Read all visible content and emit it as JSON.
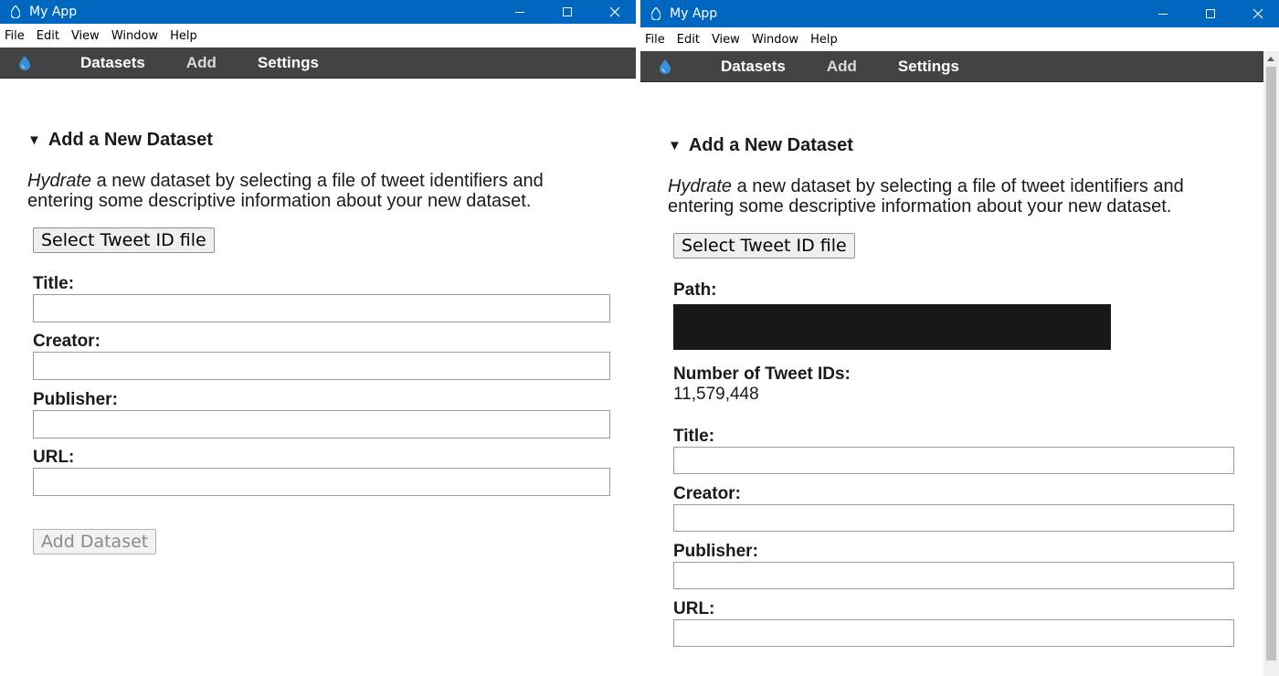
{
  "windows": [
    {
      "title": "My App",
      "menu": [
        "File",
        "Edit",
        "View",
        "Window",
        "Help"
      ],
      "nav": [
        "Datasets",
        "Add",
        "Settings"
      ],
      "section_title": "Add a New Dataset",
      "intro_em": "Hydrate",
      "intro_rest": " a new dataset by selecting a file of tweet identifiers and entering some descriptive information about your new dataset.",
      "select_button": "Select Tweet ID file",
      "fields": [
        "Title:",
        "Creator:",
        "Publisher:",
        "URL:"
      ],
      "add_button": "Add Dataset"
    },
    {
      "title": "My App",
      "menu": [
        "File",
        "Edit",
        "View",
        "Window",
        "Help"
      ],
      "nav": [
        "Datasets",
        "Add",
        "Settings"
      ],
      "section_title": "Add a New Dataset",
      "intro_em": "Hydrate",
      "intro_rest": " a new dataset by selecting a file of tweet identifiers and entering some descriptive information about your new dataset.",
      "select_button": "Select Tweet ID file",
      "path_label": "Path:",
      "count_label": "Number of Tweet IDs:",
      "count_value": "11,579,448",
      "fields": [
        "Title:",
        "Creator:",
        "Publisher:",
        "URL:"
      ]
    }
  ],
  "colors": {
    "titlebar": "#0067c0",
    "navbar": "#434343",
    "path_redacted": "#16191b"
  },
  "icons": {
    "app": "droplet-icon",
    "minimize": "minimize-icon",
    "maximize": "maximize-icon",
    "close": "close-icon"
  }
}
